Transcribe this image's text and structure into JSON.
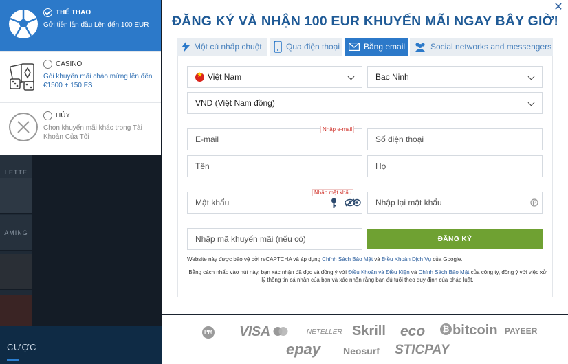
{
  "bonus_options": [
    {
      "title": "THỂ THAO",
      "desc": "Gửi tiền lần đầu Lên đến 100 EUR",
      "selected": true,
      "icon": "soccer-ball-icon"
    },
    {
      "title": "CASINO",
      "desc": "Gói khuyến mãi chào mừng lên đến €1500 + 150 FS",
      "selected": false,
      "icon": "casino-cards-dice-icon"
    },
    {
      "title": "HỦY",
      "desc": "Chọn khuyến mãi khác trong Tài Khoản Của Tôi",
      "selected": false,
      "icon": "cancel-x-icon"
    }
  ],
  "backdrop": {
    "tile_labels": [
      "LETTE",
      "",
      "AMING",
      "",
      ""
    ],
    "footer_label": "CƯỢC"
  },
  "headline": "ĐĂNG KÝ VÀ NHẬN 100 EUR KHUYẾN MÃI NGAY BÂY GIỜ!",
  "tabs": [
    {
      "label": "Một cú nhấp chuột",
      "icon": "lightning-icon",
      "active": false
    },
    {
      "label": "Qua điện thoại",
      "icon": "phone-icon",
      "active": false
    },
    {
      "label": "Bằng email",
      "icon": "envelope-icon",
      "active": true
    },
    {
      "label": "Social networks and messengers",
      "icon": "users-icon",
      "active": false
    }
  ],
  "form": {
    "country": "Việt Nam",
    "city": "Bac Ninh",
    "currency": "VND (Việt Nam đồng)",
    "email_placeholder": "E-mail",
    "email_hint": "Nhập e-mail",
    "phone_placeholder": "Số điện thoại",
    "first_name_placeholder": "Tên",
    "last_name_placeholder": "Họ",
    "password_placeholder": "Mật khẩu",
    "password_hint": "Nhập mật khẩu",
    "confirm_password_placeholder": "Nhập lại mật khẩu",
    "promo_placeholder": "Nhập mã khuyến mãi (nếu có)",
    "submit_label": "ĐĂNG KÝ"
  },
  "notes": {
    "recaptcha_prefix": "Website này được bảo vệ bởi reCAPTCHA và áp dụng ",
    "privacy_policy": "Chính Sách Bảo Mật",
    "and": " và ",
    "terms_of_service": "Điều Khoản Dịch Vụ",
    "recaptcha_suffix": " của Google.",
    "consent_prefix": "Bằng cách nhấp vào nút này, bạn xác nhận đã đọc và đồng ý với ",
    "terms_conditions": "Điều Khoản và Điều Kiện",
    "and2": " và ",
    "privacy_policy2": "Chính Sách Bảo Mật",
    "consent_suffix": " của công ty, đồng ý với việc xử lý thông tin cá nhân của bạn và xác nhận rằng bạn đủ tuổi theo quy định của pháp luật."
  },
  "payment_logos": [
    "PM",
    "VISA",
    "NETELLER",
    "Skrill",
    "eco",
    "bitcoin",
    "PAYEER",
    "epay",
    "Neosurf",
    "STICPAY"
  ],
  "colors": {
    "accent": "#2c79c9",
    "headline": "#1f5a96",
    "submit": "#6fa132",
    "hint": "#d0342c"
  }
}
